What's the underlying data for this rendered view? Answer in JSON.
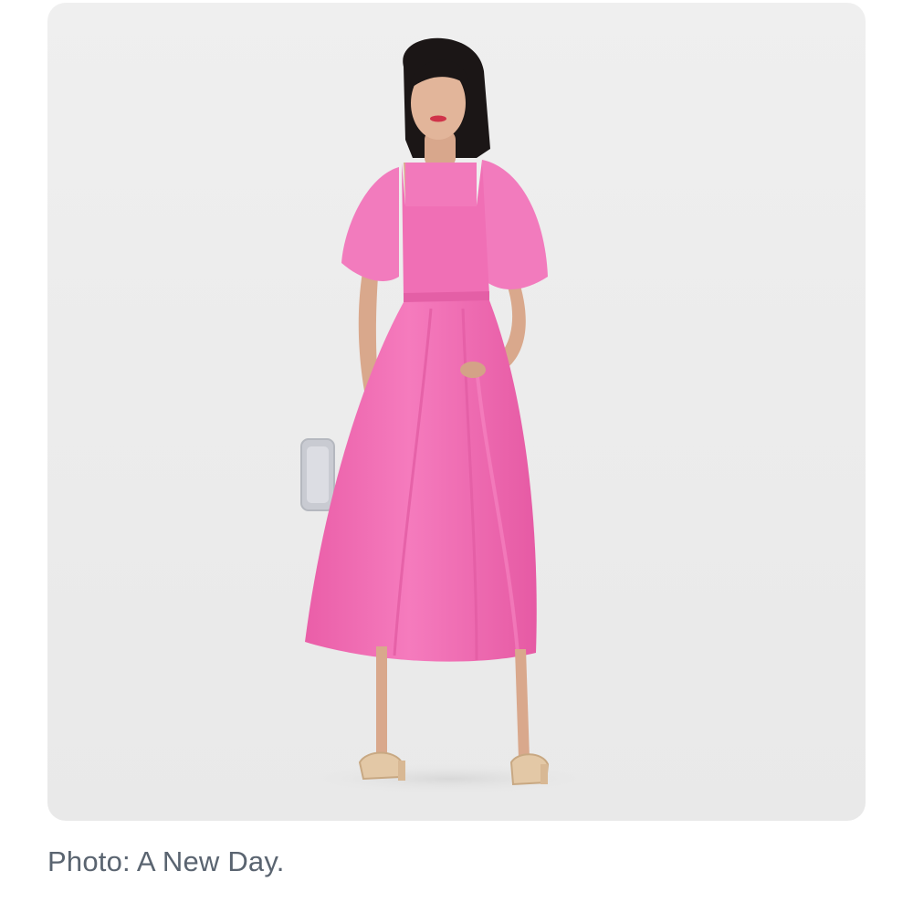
{
  "article": {
    "image": {
      "subject_icon": "model-in-pink-dress-photo",
      "dress_color": "#f06fb5",
      "background_color": "#ededed"
    },
    "caption": "Photo: A New Day."
  }
}
